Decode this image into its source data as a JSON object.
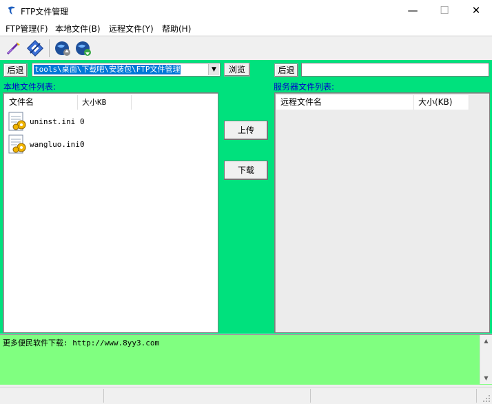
{
  "window": {
    "title": "FTP文件管理"
  },
  "menu": [
    "FTP管理(F)",
    "本地文件(B)",
    "远程文件(Y)",
    "帮助(H)"
  ],
  "toolbar": {
    "icons": [
      "connect-icon",
      "disconnect-icon",
      "upload-globe-icon",
      "download-globe-icon"
    ]
  },
  "local": {
    "back_label": "后退",
    "path": "tools\\桌面\\下载吧\\安装包\\FTP文件管理",
    "browse_label": "浏览",
    "list_label": "本地文件列表:",
    "columns": [
      "文件名",
      "大小KB"
    ],
    "files": [
      {
        "name": "uninst.ini",
        "size": "0"
      },
      {
        "name": "wangluo.ini",
        "size": "0"
      }
    ]
  },
  "remote": {
    "back_label": "后退",
    "path": "",
    "list_label": "服务器文件列表:",
    "columns": [
      "远程文件名",
      "大小(KB)"
    ]
  },
  "transfer": {
    "upload_label": "上传",
    "download_label": "下载"
  },
  "info": {
    "text": "更多便民软件下载: http://www.8yy3.com"
  },
  "colors": {
    "main_bg": "#00e17d",
    "info_bg": "#80ff80",
    "label_color": "#0000cc"
  }
}
